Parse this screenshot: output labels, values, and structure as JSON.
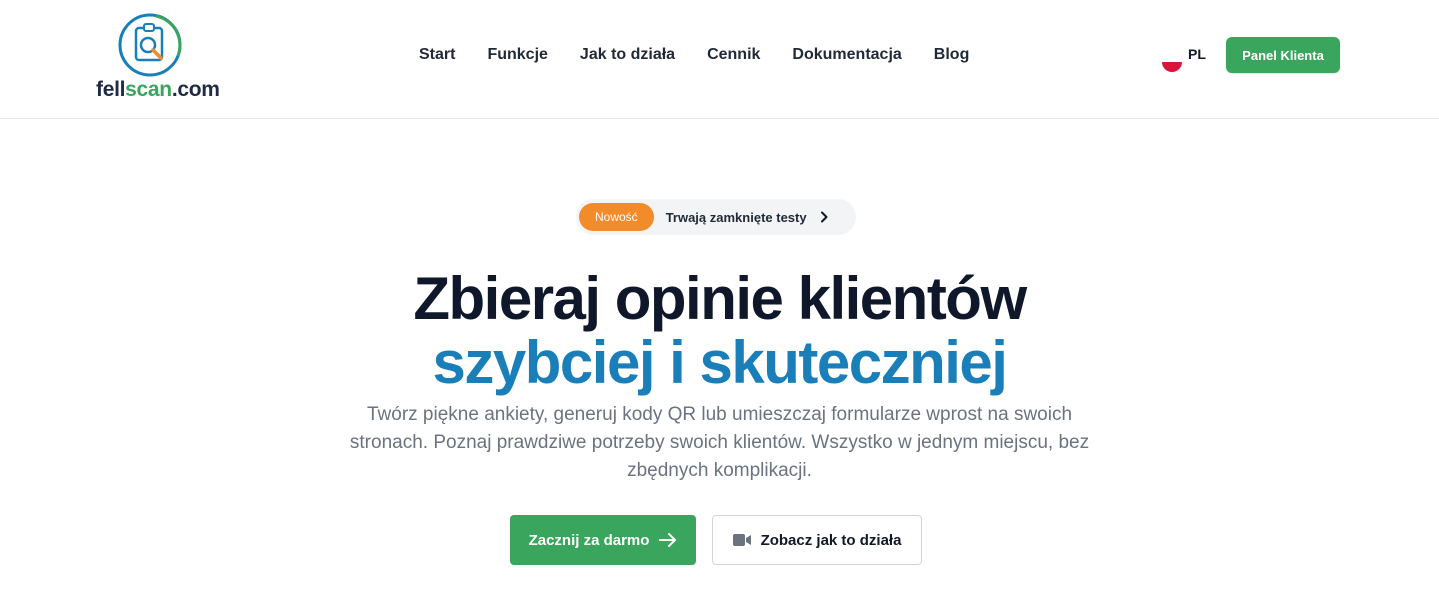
{
  "brand": {
    "logo_part1": "fell",
    "logo_part2": "scan",
    "logo_part3": ".com",
    "logo_icon": "clipboard-magnifier-icon",
    "colors": {
      "green": "#3aa55c",
      "blue": "#1a7fb8",
      "navy": "#1f2a44"
    }
  },
  "nav": {
    "items": [
      {
        "label": "Start"
      },
      {
        "label": "Funkcje"
      },
      {
        "label": "Jak to działa"
      },
      {
        "label": "Cennik"
      },
      {
        "label": "Dokumentacja"
      },
      {
        "label": "Blog"
      }
    ]
  },
  "language": {
    "code": "PL",
    "icon": "poland-flag-icon"
  },
  "header_cta": {
    "label": "Panel Klienta"
  },
  "announcement": {
    "badge": "Nowość",
    "text": "Trwają zamknięte testy",
    "icon": "chevron-right-icon",
    "badge_color": "#f28b2a"
  },
  "hero": {
    "title_line1": "Zbieraj opinie klientów",
    "title_line2": "szybciej i skuteczniej",
    "lead": "Twórz piękne ankiety, generuj kody QR lub umieszczaj formularze wprost na swoich stronach. Poznaj prawdziwe potrzeby swoich klientów. Wszystko w jednym miejscu, bez zbędnych komplikacji."
  },
  "cta": {
    "primary_label": "Zacznij za darmo",
    "primary_icon": "arrow-right-icon",
    "secondary_label": "Zobacz jak to działa",
    "secondary_icon": "video-camera-icon"
  }
}
